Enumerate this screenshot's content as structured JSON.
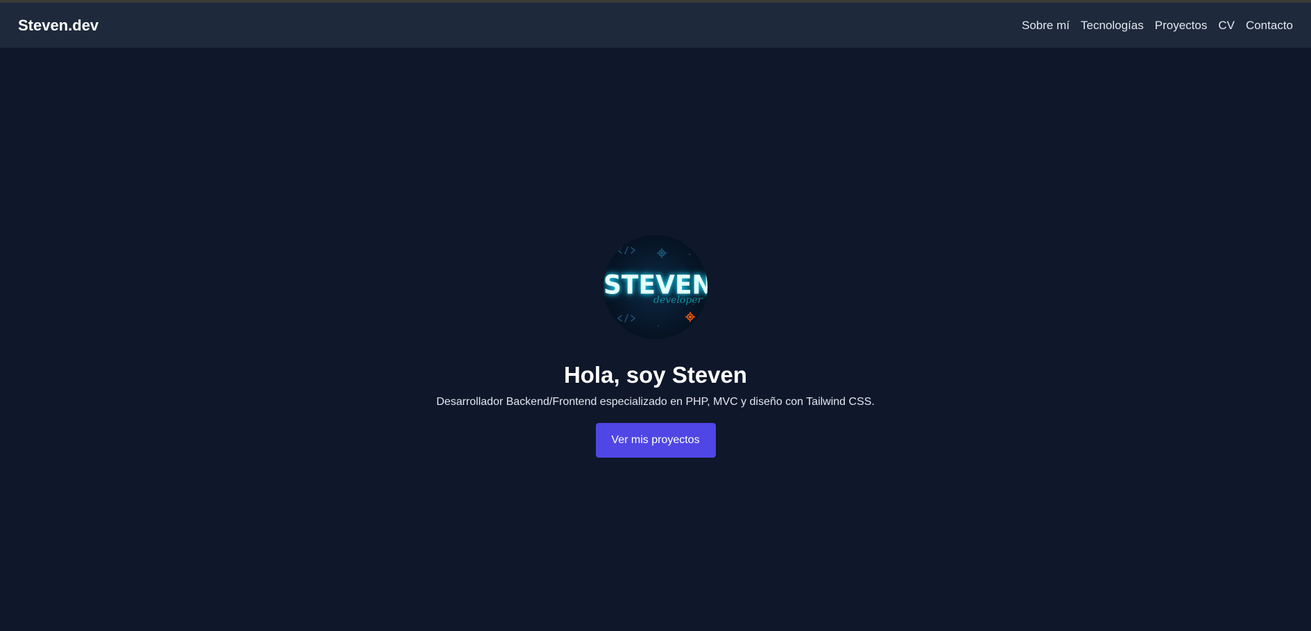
{
  "colors": {
    "page_background": "#0f172a",
    "navbar_background": "#1e293b",
    "button_background": "#4f46e5",
    "logo_glow": "#22d3ee",
    "logo_gear_accent": "#ea580c"
  },
  "navbar": {
    "brand": "Steven.dev",
    "links": [
      {
        "label": "Sobre mí"
      },
      {
        "label": "Tecnologías"
      },
      {
        "label": "Proyectos"
      },
      {
        "label": "CV"
      },
      {
        "label": "Contacto"
      }
    ]
  },
  "hero": {
    "avatar": {
      "logo_text": "STEVEN",
      "logo_subtext": "developer",
      "icons": [
        "code-icon",
        "gear-icon"
      ]
    },
    "title": "Hola, soy Steven",
    "subtitle": "Desarrollador Backend/Frontend especializado en PHP, MVC y diseño con Tailwind CSS.",
    "button_label": "Ver mis proyectos"
  }
}
